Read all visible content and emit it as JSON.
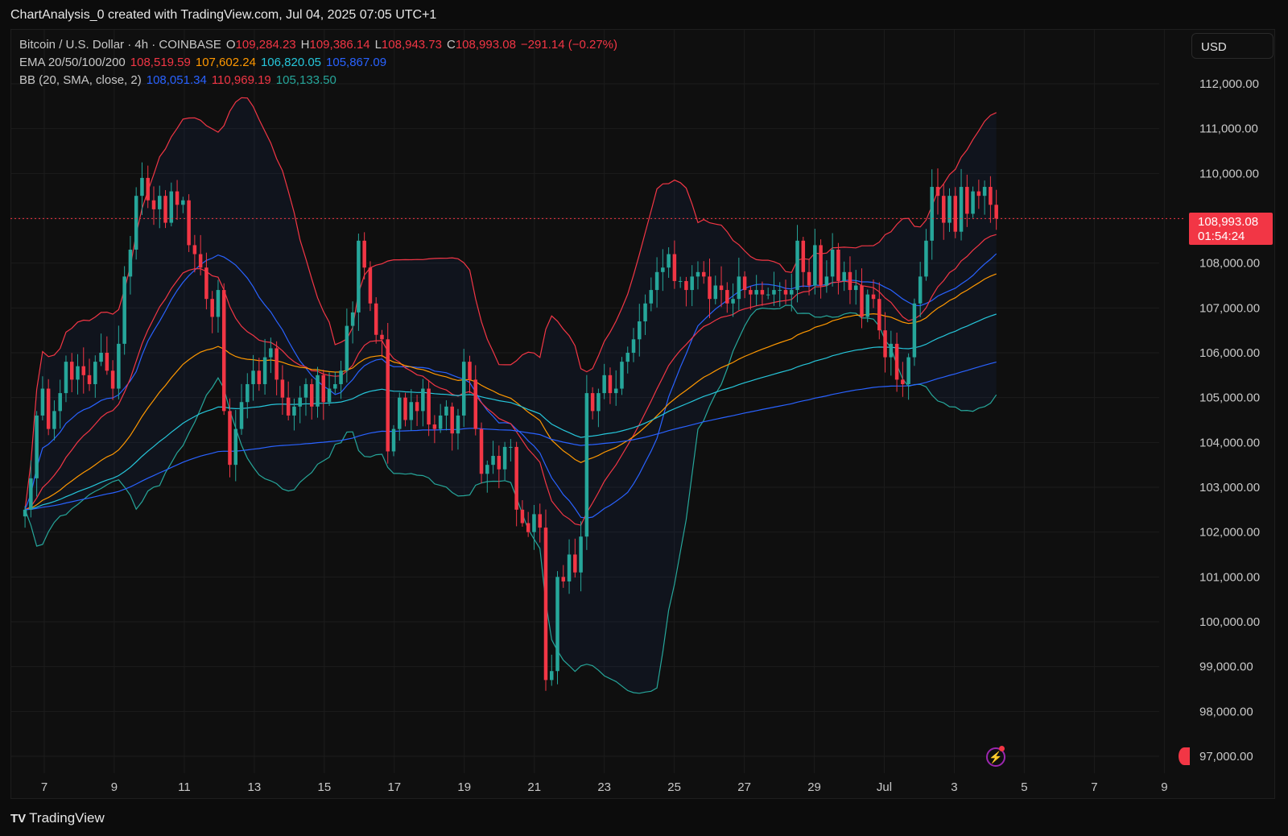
{
  "caption": "ChartAnalysis_0 created with TradingView.com, Jul 04, 2025 07:05 UTC+1",
  "legend": {
    "symbol": "Bitcoin / U.S. Dollar · 4h · COINBASE",
    "open_label": "O",
    "open": "109,284.23",
    "high_label": "H",
    "high": "109,386.14",
    "low_label": "L",
    "low": "108,943.73",
    "close_label": "C",
    "close": "108,993.08",
    "change": "−291.14 (−0.27%)",
    "ema_label": "EMA 20/50/100/200",
    "ema20": "108,519.59",
    "ema50": "107,602.24",
    "ema100": "106,820.05",
    "ema200": "105,867.09",
    "bb_label": "BB (20, SMA, close, 2)",
    "bb_basis": "108,051.34",
    "bb_upper": "110,969.19",
    "bb_lower": "105,133.50"
  },
  "currency": "USD",
  "last_price": {
    "price": "108,993.08",
    "countdown": "01:54:24"
  },
  "footer_brand": "TradingView",
  "colors": {
    "up": "#26a69a",
    "down": "#f23645",
    "ema20": "#f23645",
    "ema50": "#ff9800",
    "ema100": "#26c6da",
    "ema200": "#2962ff",
    "bb_upper": "#f23645",
    "bb_lower": "#26a69a",
    "bb_basis": "#2962ff"
  },
  "chart_data": {
    "type": "candlestick",
    "symbol": "BTC/USD",
    "timeframe": "4h",
    "ylim": [
      96900,
      112800
    ],
    "y_ticks": [
      "112,000.00",
      "111,000.00",
      "110,000.00",
      "109,000.00",
      "108,000.00",
      "107,000.00",
      "106,000.00",
      "105,000.00",
      "104,000.00",
      "103,000.00",
      "102,000.00",
      "101,000.00",
      "100,000.00",
      "99,000.00",
      "98,000.00",
      "97,000.00"
    ],
    "x_ticks": [
      "7",
      "9",
      "11",
      "13",
      "15",
      "17",
      "19",
      "21",
      "23",
      "25",
      "27",
      "29",
      "Jul",
      "3",
      "5",
      "7",
      "9"
    ],
    "x_tick_days": [
      7,
      9,
      11,
      13,
      15,
      17,
      19,
      21,
      23,
      25,
      27,
      29,
      31,
      33,
      35,
      37,
      39
    ],
    "xlim_days": [
      6.45,
      39.8
    ],
    "last_day": 34.2,
    "closes": [
      102500,
      103200,
      104600,
      105200,
      104300,
      104700,
      105100,
      105800,
      105400,
      105700,
      105500,
      105300,
      105800,
      106000,
      105600,
      105200,
      106200,
      107700,
      108300,
      109500,
      109900,
      109400,
      109200,
      109500,
      108900,
      109600,
      109300,
      109400,
      108400,
      108200,
      107900,
      107200,
      106800,
      107400,
      104700,
      103500,
      104300,
      104900,
      105300,
      105600,
      105300,
      105900,
      106100,
      105400,
      105000,
      104600,
      104800,
      105000,
      105300,
      104800,
      105500,
      104900,
      105200,
      105300,
      105600,
      106600,
      106900,
      108500,
      107900,
      107100,
      106400,
      106300,
      103800,
      104300,
      105000,
      104500,
      104900,
      104700,
      105200,
      104400,
      104300,
      104600,
      104800,
      104200,
      104600,
      105800,
      105400,
      104300,
      103300,
      103500,
      103700,
      103400,
      103900,
      103900,
      102500,
      102200,
      102000,
      102400,
      102100,
      98700,
      98900,
      101000,
      100900,
      101500,
      101100,
      101900,
      105100,
      104700,
      105100,
      105500,
      105100,
      105200,
      105800,
      106000,
      106300,
      106700,
      107100,
      107400,
      107800,
      107900,
      108200,
      107600,
      107600,
      107400,
      107700,
      107800,
      107700,
      107200,
      107500,
      107400,
      107100,
      107200,
      107700,
      107400,
      107300,
      107400,
      107300,
      107300,
      107400,
      107400,
      107300,
      107400,
      108500,
      107800,
      107500,
      108400,
      107500,
      107700,
      108300,
      107600,
      107800,
      107400,
      107500,
      106800,
      107300,
      107200,
      106500,
      105900,
      106200,
      105400,
      105300,
      105900,
      107100,
      107700,
      108500,
      109700,
      109500,
      108900,
      109500,
      108700,
      109700,
      109100,
      109600,
      109500,
      109700,
      109300,
      108993
    ]
  }
}
